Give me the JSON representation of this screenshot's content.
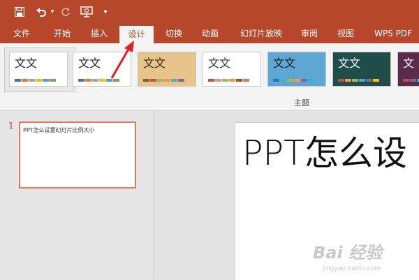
{
  "quick_access": {
    "icons": [
      "save-icon",
      "undo-icon",
      "undo-dropdown-icon",
      "redo-icon",
      "present-from-start-icon",
      "customize-qat-icon"
    ]
  },
  "tabs": [
    {
      "label": "文件",
      "active": false
    },
    {
      "label": "开始",
      "active": false
    },
    {
      "label": "插入",
      "active": false
    },
    {
      "label": "设计",
      "active": true
    },
    {
      "label": "切换",
      "active": false
    },
    {
      "label": "动画",
      "active": false
    },
    {
      "label": "幻灯片放映",
      "active": false
    },
    {
      "label": "审阅",
      "active": false
    },
    {
      "label": "视图",
      "active": false
    },
    {
      "label": "WPS PDF",
      "active": false
    }
  ],
  "themes": {
    "group_label": "主题",
    "items": [
      {
        "text": "文文",
        "text_color": "#222222",
        "bg": "#ffffff",
        "swatches": [
          "#4472c4",
          "#ed7d31",
          "#a5a5a5",
          "#ffc000",
          "#5b9bd5",
          "#70ad47"
        ]
      },
      {
        "text": "文文",
        "text_color": "#222222",
        "bg": "#ffffff",
        "swatches": [
          "#4472c4",
          "#ed7d31",
          "#a5a5a5",
          "#ffc000",
          "#5b9bd5",
          "#70ad47"
        ]
      },
      {
        "text": "文文",
        "text_color": "#3a2a10",
        "bg": "#e6c48a",
        "swatches": [
          "#8b5a2b",
          "#c0504d",
          "#9bbb59",
          "#f79646",
          "#4bacc6",
          "#8064a2"
        ]
      },
      {
        "text": "文文",
        "text_color": "#333333",
        "bg": "#ffffff",
        "swatches": [
          "#c0504d",
          "#d99694",
          "#9bbb59",
          "#f79646",
          "#8b5a2b",
          "#e07a5f"
        ]
      },
      {
        "text": "文文",
        "text_color": "#1a1a1a",
        "bg": "#5ea6d4",
        "swatches": [
          "#1f77b4",
          "#4bacc6",
          "#9bbb59",
          "#f79646",
          "#8064a2",
          "#17becf"
        ]
      },
      {
        "text": "文文",
        "text_color": "#ffffff",
        "bg": "#1f4e4a",
        "swatches": [
          "#c0504d",
          "#f79646",
          "#9bbb59",
          "#4bacc6",
          "#8064a2",
          "#ffc000"
        ]
      },
      {
        "text": "文",
        "text_color": "#ffffff",
        "bg": "#5a2a4a",
        "swatches": [
          "#c0504d",
          "#8064a2",
          "#4bacc6"
        ]
      }
    ]
  },
  "slides_panel": {
    "slide_number": "1",
    "thumbnail_text": "PPT怎么设置幻灯片比例大小"
  },
  "slide": {
    "title": "PPT怎么设"
  },
  "watermark": {
    "line1": "Bai 经验",
    "line2": "jingyan.baidu.com"
  },
  "colors": {
    "accent": "#b7472a",
    "arrow": "#e02020"
  }
}
